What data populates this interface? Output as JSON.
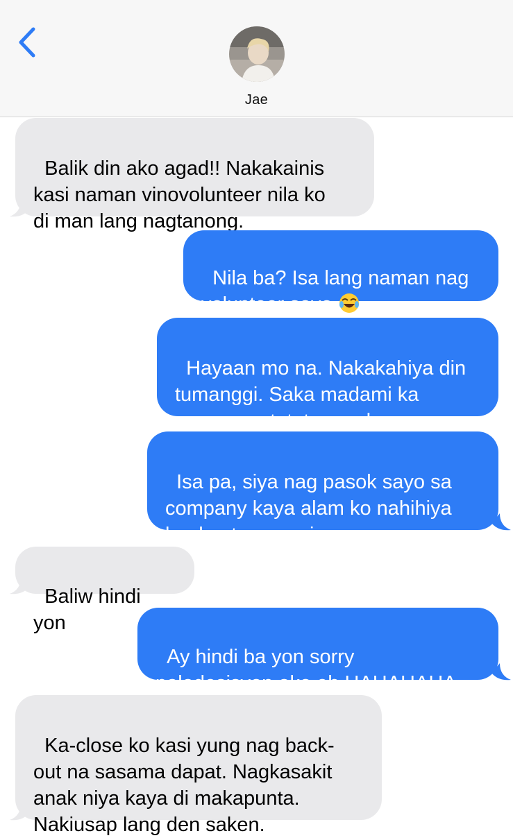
{
  "header": {
    "contact_name": "Jae",
    "back_icon": "chevron-left-icon",
    "accent": "#2e7cf6"
  },
  "messages": [
    {
      "from": "received",
      "text": "Balik din ako agad!! Nakakainis\nkasi naman vinovolunteer nila ko\ndi man lang nagtanong."
    },
    {
      "from": "sent",
      "text": "Nila ba? Isa lang naman nag\nvolunteer sayo ",
      "emoji": "face-with-tears-of-joy"
    },
    {
      "from": "sent",
      "text": "Hayaan mo na. Nakakahiya din\ntumanggi. Saka madami ka\nnaman matututunan don."
    },
    {
      "from": "sent",
      "text": "Isa pa, siya nag pasok sayo sa\ncompany kaya alam ko nahihiya\nka den tumanggi."
    },
    {
      "from": "received",
      "text": "Baliw hindi yon"
    },
    {
      "from": "sent",
      "text": "Ay hindi ba yon sorry\npaladesisyon ako eh HAHAHAHA"
    },
    {
      "from": "received",
      "text": "Ka-close ko kasi yung nag back-\nout na sasama dapat. Nagkasakit\nanak niya kaya di makapunta.\nNakiusap lang den saken."
    }
  ]
}
